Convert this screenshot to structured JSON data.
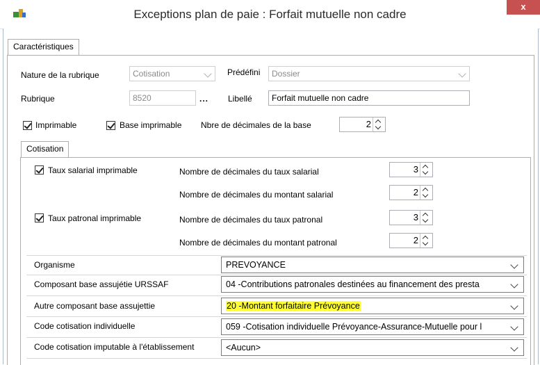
{
  "window": {
    "title": "Exceptions plan de paie  :  Forfait mutuelle non cadre",
    "close_label": "x"
  },
  "tabs": {
    "main": "Caractéristiques",
    "sub": "Cotisation"
  },
  "form": {
    "nature_label": "Nature de la rubrique",
    "nature_value": "Cotisation",
    "predefini_label": "Prédéfini",
    "predefini_value": "Dossier",
    "rubrique_label": "Rubrique",
    "rubrique_value": "8520",
    "rubrique_browse": "...",
    "libelle_label": "Libellé",
    "libelle_value": "Forfait mutuelle non cadre",
    "imprimable_label": "Imprimable",
    "base_imprimable_label": "Base imprimable",
    "nbre_decimales_base_label": "Nbre de décimales de la base",
    "nbre_decimales_base_value": "2"
  },
  "cotisation": {
    "taux_salarial_label": "Taux salarial imprimable",
    "taux_patronal_label": "Taux patronal imprimable",
    "dec_taux_salarial_label": "Nombre de décimales du taux salarial",
    "dec_taux_salarial_value": "3",
    "dec_montant_salarial_label": "Nombre de décimales du montant salarial",
    "dec_montant_salarial_value": "2",
    "dec_taux_patronal_label": "Nombre de décimales du taux patronal",
    "dec_taux_patronal_value": "3",
    "dec_montant_patronal_label": "Nombre de décimales du montant patronal",
    "dec_montant_patronal_value": "2"
  },
  "fields": {
    "organisme_label": "Organisme",
    "organisme_value": "PREVOYANCE",
    "composant_urssaf_label": "Composant base  assujétie URSSAF",
    "composant_urssaf_value": "04  -Contributions patronales destinées au financement des presta",
    "autre_composant_label": "Autre composant base  assujettie",
    "autre_composant_value": "20  -Montant forfaitaire Prévoyance",
    "code_individuelle_label": "Code cotisation individuelle",
    "code_individuelle_value": "059 -Cotisation individuelle Prévoyance-Assurance-Mutuelle pour l",
    "code_imputable_label": "Code cotisation imputable à l'établissement",
    "code_imputable_value": "<Aucun>"
  },
  "colors": {
    "highlight": "#ffff33",
    "close_button": "#c75050"
  }
}
